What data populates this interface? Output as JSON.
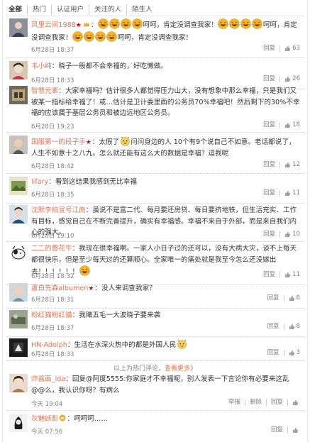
{
  "tabs": [
    "全部",
    "热门",
    "认证用户",
    "关注的人",
    "陌生人"
  ],
  "reply_label": "回复",
  "comments": [
    {
      "user": "风里云间1988",
      "sep": "：",
      "text_a": "呵呵，肯定没调查我家！",
      "text_b": "呵呵，肯定没调查我家！",
      "text_c": "呵呵，肯定没调查我家！",
      "time": "6月28日 18:37",
      "likes": "63"
    },
    {
      "user": "韦小纯",
      "sep": "：",
      "text": "晓子一般都不会幸福的，好吃懒做。",
      "time": "6月28日 18:33",
      "likes": "26"
    },
    {
      "user": "智慧元素",
      "sep": "：",
      "text": "大家幸福吗？估计很多人都觉得压力山大，没有想象中那么幸福，只是我们又被某一指标给幸福了！或…估计是卫计委里面的公务员70%幸福吧！然后剩下的30%不幸福的应该属于基层公务员和被边远地区公务员。",
      "time": "6月28日 19:23",
      "likes": "18"
    },
    {
      "user": "国服第一的段子手",
      "sep": "：",
      "text_a": "太假了",
      "text_b": "问问身边的人 10个有9个说自己不如意。老话都说了，人生不如意十之八九。怎么就还能有这么大的数据是幸福？逗我呢",
      "time": "6月28日 18:42",
      "likes": "12"
    },
    {
      "user": "lifary",
      "sep": "：",
      "text": "看到这结果我感到无比幸福",
      "time": "6月28日 18:35",
      "likes": "11"
    },
    {
      "user": "沈默李拍宣号江南",
      "sep": "：",
      "text": "虽说不是富二代、每月要还房贷、每日要挤地铁，但生活充实、工作有目标，感觉自己在不断完善提升，确实有幸福感。幸福不来自于外部，而是来自我们内心的强大。",
      "time": "6月28日 19:10",
      "likes": "10"
    },
    {
      "user": "二二的憨花牛",
      "sep": "：",
      "text": "我现在很幸福啊。一家人小日子过的还可以，没有大病大灾，谈不上每天都很快乐，但是至少每天过的还算顺心。全家唯一的痛处就是我至今怎么还没嫁出去！！！！！！",
      "time": "6月28日 18:32",
      "likes": "11"
    },
    {
      "user": "蘆白先森albumen",
      "sep": "：",
      "text": "没人来调查我家？",
      "time": "6月28日 18:31",
      "likes": "8"
    },
    {
      "user": "粉红猫粉红猫",
      "sep": "：",
      "text": "我赌五毛一大波晓子要来袭",
      "time": "6月28日 18:37",
      "likes": "8"
    },
    {
      "user": "HN-Adolph",
      "sep": "：",
      "text": "生活在水深火热中的都是外国人民",
      "time": "6月28日 18:33",
      "likes": "3"
    },
    {
      "user": "炸酱面_lda",
      "sep": "：",
      "text": "回复@阿度5555:你家庭才不幸福呢，别人发表一下言论你有必要来这乱@@么，我认识你呀？有病么",
      "time": "今天 19:04",
      "reply": "举报",
      "act2": "删除",
      "act3": "回复",
      "likes": ""
    },
    {
      "user": "灰魅妖影",
      "sep": "：",
      "text": "呵呵呵……",
      "time": "今天 07:56",
      "likes": ""
    }
  ],
  "more": {
    "prefix": "以上为热门评论，",
    "link": "查看更多》"
  },
  "colors": {
    "accent": "#eb7350",
    "meta": "#808080",
    "vip": "#e60012",
    "emoji": "#f6b51e"
  },
  "icons": {
    "like": "thumbs-up-icon",
    "emoji": "laughing-emoji-icon",
    "vip": "vip-star-icon"
  }
}
